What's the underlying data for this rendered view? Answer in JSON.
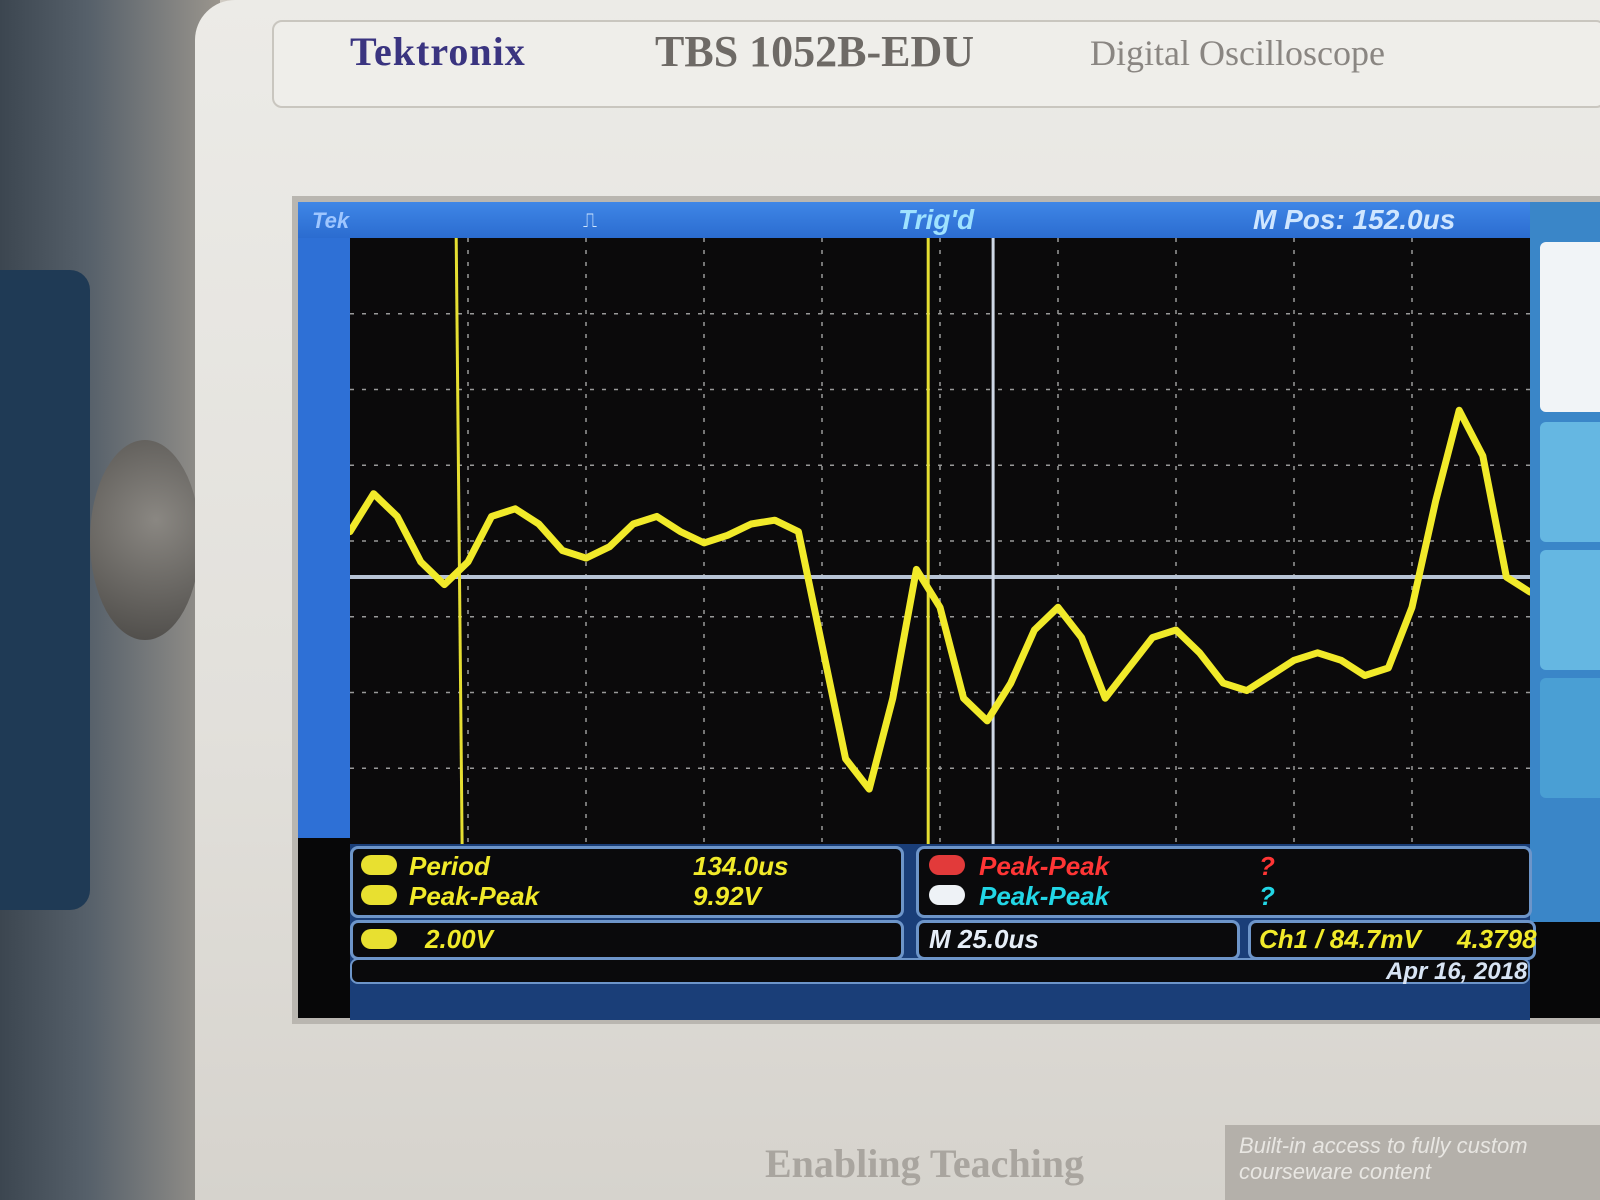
{
  "panel": {
    "brand": "Tektronix",
    "model": "TBS 1052B-EDU",
    "description": "Digital Oscilloscope",
    "tagline": "Enabling Teaching",
    "promo": "Built-in access to fully custom courseware content"
  },
  "scope": {
    "top_left": "Tek",
    "trigger_state": "Trig'd",
    "horizontal_position": "M Pos: 152.0us",
    "measurements": [
      {
        "label": "Period",
        "value": "134.0us",
        "color": "#f1ea2a"
      },
      {
        "label": "Peak-Peak",
        "value": "9.92V",
        "color": "#f1ea2a"
      },
      {
        "label": "Peak-Peak",
        "value": "?",
        "color": "#ff3535"
      },
      {
        "label": "Peak-Peak",
        "value": "?",
        "color": "#22d6e6"
      }
    ],
    "channel_scale": "2.00V",
    "timebase": "M 25.0us",
    "trigger": "Ch1 / 84.7mV",
    "frequency": "4.3798",
    "date": "Apr 16, 2018",
    "trace_color": "#f1ea2a",
    "waveform": {
      "x_div": [
        0,
        0.2,
        0.4,
        0.6,
        0.8,
        1.0,
        1.2,
        1.4,
        1.6,
        1.8,
        2.0,
        2.2,
        2.4,
        2.6,
        2.8,
        3.0,
        3.2,
        3.4,
        3.6,
        3.8,
        4.0,
        4.2,
        4.4,
        4.6,
        4.8,
        5.0,
        5.2,
        5.4,
        5.6,
        5.8,
        6.0,
        6.2,
        6.4,
        6.6,
        6.8,
        7.0,
        7.2,
        7.4,
        7.6,
        7.8,
        8.0,
        8.2,
        8.4,
        8.6,
        8.8,
        9.0,
        9.2,
        9.4,
        9.6,
        9.8,
        10.0
      ],
      "y_div": [
        0.6,
        1.1,
        0.8,
        0.2,
        -0.1,
        0.2,
        0.8,
        0.9,
        0.7,
        0.35,
        0.25,
        0.4,
        0.7,
        0.8,
        0.6,
        0.45,
        0.55,
        0.7,
        0.75,
        0.6,
        -0.9,
        -2.4,
        -2.8,
        -1.6,
        0.1,
        -0.4,
        -1.6,
        -1.9,
        -1.4,
        -0.7,
        -0.4,
        -0.8,
        -1.6,
        -1.2,
        -0.8,
        -0.7,
        -1.0,
        -1.4,
        -1.5,
        -1.3,
        -1.1,
        -1.0,
        -1.1,
        -1.3,
        -1.2,
        -0.4,
        1.0,
        2.2,
        1.6,
        0.0,
        -0.2
      ]
    }
  }
}
